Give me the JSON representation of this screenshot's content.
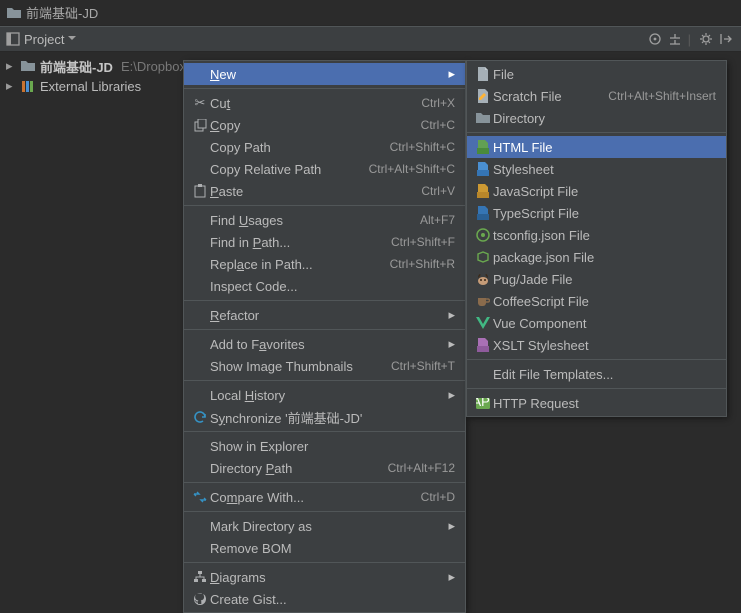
{
  "breadcrumb": {
    "project": "前端基础-JD"
  },
  "panel": {
    "title": "Project"
  },
  "tree": {
    "root": {
      "name": "前端基础-JD",
      "path": "E:\\Dropbox\\..."
    },
    "libs": {
      "name": "External Libraries"
    }
  },
  "ctx": {
    "new": "New",
    "cut": "Cut",
    "cut_sc": "Ctrl+X",
    "copy": "Copy",
    "copy_sc": "Ctrl+C",
    "copy_path": "Copy Path",
    "copy_path_sc": "Ctrl+Shift+C",
    "copy_rel": "Copy Relative Path",
    "copy_rel_sc": "Ctrl+Alt+Shift+C",
    "paste": "Paste",
    "paste_sc": "Ctrl+V",
    "find_usages": "Find Usages",
    "find_usages_sc": "Alt+F7",
    "find_in_path": "Find in Path...",
    "find_in_path_sc": "Ctrl+Shift+F",
    "replace_in_path": "Replace in Path...",
    "replace_in_path_sc": "Ctrl+Shift+R",
    "inspect": "Inspect Code...",
    "refactor": "Refactor",
    "add_fav": "Add to Favorites",
    "thumbs": "Show Image Thumbnails",
    "thumbs_sc": "Ctrl+Shift+T",
    "local_hist": "Local History",
    "sync": "Synchronize '前端基础-JD'",
    "explorer": "Show in Explorer",
    "dir_path": "Directory Path",
    "dir_path_sc": "Ctrl+Alt+F12",
    "compare": "Compare With...",
    "compare_sc": "Ctrl+D",
    "mark_as": "Mark Directory as",
    "remove_bom": "Remove BOM",
    "diagrams": "Diagrams",
    "gist": "Create Gist..."
  },
  "sub": {
    "file": "File",
    "scratch": "Scratch File",
    "scratch_sc": "Ctrl+Alt+Shift+Insert",
    "directory": "Directory",
    "html": "HTML File",
    "stylesheet": "Stylesheet",
    "js": "JavaScript File",
    "ts": "TypeScript File",
    "tsconfig": "tsconfig.json File",
    "package": "package.json File",
    "pug": "Pug/Jade File",
    "coffee": "CoffeeScript File",
    "vue": "Vue Component",
    "xslt": "XSLT Stylesheet",
    "edit_tpl": "Edit File Templates...",
    "http": "HTTP Request"
  }
}
